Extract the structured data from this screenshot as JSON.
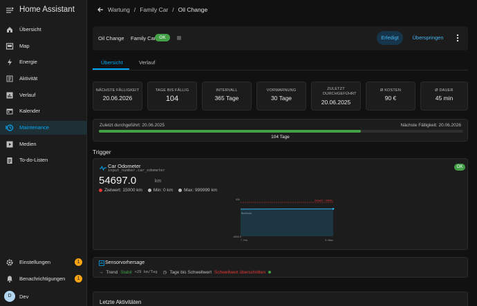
{
  "app": {
    "title": "Home Assistant"
  },
  "sidebar": {
    "items": [
      {
        "label": "Übersicht",
        "icon": "view-dashboard-icon"
      },
      {
        "label": "Map",
        "icon": "map-icon"
      },
      {
        "label": "Energie",
        "icon": "lightning-icon"
      },
      {
        "label": "Aktivität",
        "icon": "list-icon"
      },
      {
        "label": "Verlauf",
        "icon": "chart-box-icon"
      },
      {
        "label": "Kalender",
        "icon": "calendar-icon"
      },
      {
        "label": "Maintenance",
        "icon": "clock-icon"
      },
      {
        "label": "Medien",
        "icon": "play-box-icon"
      },
      {
        "label": "To-do-Listen",
        "icon": "clipboard-list-icon"
      }
    ],
    "settings_label": "Einstellungen",
    "settings_badge": "1",
    "notifications_label": "Benachrichtigungen",
    "notifications_badge": "1",
    "user_initial": "D",
    "user_name": "Dev"
  },
  "breadcrumb": {
    "level1": "Wartung",
    "level2": "Family Car",
    "current": "Oil Change"
  },
  "toolbar": {
    "task_name": "Oil Change",
    "object": "Family Car",
    "status": "OK",
    "done_label": "Erledigt",
    "skip_label": "Überspringen"
  },
  "tabs": [
    "Übersicht",
    "Verlauf"
  ],
  "stats": [
    {
      "key": "NÄCHSTE FÄLLIGKEIT",
      "value": "20.06.2026"
    },
    {
      "key": "TAGE BIS FÄLLIG",
      "value": "104"
    },
    {
      "key": "INTERVALL",
      "value": "365 Tage"
    },
    {
      "key": "VORWARNUNG",
      "value": "30 Tage"
    },
    {
      "key": "ZULETZT DURCHGEFÜHRT",
      "value": "20.06.2025"
    },
    {
      "key": "Ø KOSTEN",
      "value": "90 €"
    },
    {
      "key": "Ø DAUER",
      "value": "45 min"
    }
  ],
  "progress": {
    "last_done": "Zuletzt durchgeführt: 20.06.2025",
    "next_due": "Nächste Fälligkeit: 20.06.2026",
    "days_label": "104 Tage",
    "fraction": 0.72
  },
  "trigger": {
    "heading": "Trigger",
    "title": "Car Odometer",
    "entity": "input_number.car_odometer",
    "status": "OK",
    "value": "54697.0",
    "unit": "km",
    "target": "Zielwert: 15000 km",
    "min": "Min: 0 km",
    "max": "Max: 999999 km",
    "colors": {
      "target": "#e53935",
      "series": "#29b6f6"
    }
  },
  "chart_data": {
    "type": "line",
    "y_top_label": "60k",
    "y_bottom_label": "-6000.0",
    "threshold_label": "Zielwert: +15000",
    "baseline_label": "Bis/Heute",
    "x_start_label": "7. Feb.",
    "x_end_label": "9. März",
    "series": [
      {
        "values": [
          54000,
          54697
        ]
      }
    ]
  },
  "forecast": {
    "title": "Sensorvorhersage",
    "trend_label": "Trend",
    "trend_value": "Stabil",
    "rate": "+29 km/Tag",
    "threshold_label": "Tage bis Schwellwert",
    "threshold_value": "Schwellwert überschritten"
  },
  "activities": {
    "title": "Letzte Aktivitäten"
  }
}
